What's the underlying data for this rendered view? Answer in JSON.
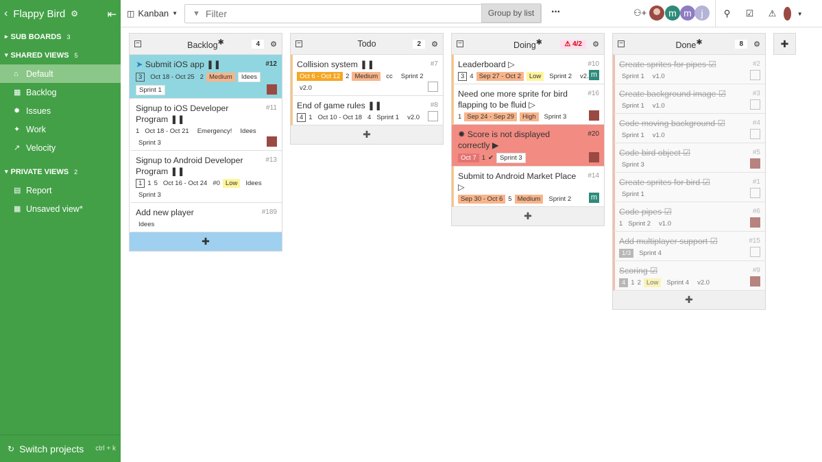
{
  "sidebar": {
    "project_name": "Flappy Bird",
    "sub_boards": {
      "label": "SUB BOARDS",
      "count": "3"
    },
    "shared_views": {
      "label": "SHARED VIEWS",
      "count": "5"
    },
    "shared_items": [
      "Default",
      "Backlog",
      "Issues",
      "Work",
      "Velocity"
    ],
    "private_views": {
      "label": "PRIVATE VIEWS",
      "count": "2"
    },
    "private_items": [
      "Report",
      "Unsaved view*"
    ],
    "switch_label": "Switch projects",
    "switch_shortcut": "ctrl + k"
  },
  "topbar": {
    "view": "Kanban",
    "filter_placeholder": "Filter",
    "group_by": "Group by list",
    "avatars": [
      "m",
      "m",
      "j"
    ]
  },
  "columns": {
    "backlog": {
      "title": "Backlog",
      "count": "4",
      "cards": [
        {
          "title": "Submit iOS app",
          "num": "#12",
          "meta": [
            "3",
            "Oct 18 - Oct 25",
            "2",
            "Medium",
            "Idees",
            "Sprint 1"
          ]
        },
        {
          "title": "Signup to iOS Developer Program",
          "num": "#11",
          "meta": [
            "1",
            "Oct 18 - Oct 21",
            "Emergency!",
            "Idees",
            "Sprint 3"
          ]
        },
        {
          "title": "Signup to Android Developer Program",
          "num": "#13",
          "meta": [
            "1",
            "1",
            "5",
            "Oct 16 - Oct 24",
            "#0",
            "Low",
            "Idees",
            "Sprint 3"
          ]
        },
        {
          "title": "Add new player",
          "num": "#189",
          "meta": [
            "Idees"
          ]
        }
      ]
    },
    "todo": {
      "title": "Todo",
      "count": "2",
      "cards": [
        {
          "title": "Collision system",
          "num": "#7",
          "meta": [
            "Oct 6 - Oct 12",
            "2",
            "Medium",
            "cc",
            "Sprint 2",
            "v2.0"
          ]
        },
        {
          "title": "End of game rules",
          "num": "#8",
          "meta": [
            "4",
            "1",
            "Oct 10 - Oct 18",
            "4",
            "Sprint 1",
            "v2.0"
          ]
        }
      ]
    },
    "doing": {
      "title": "Doing",
      "count": "4/2",
      "cards": [
        {
          "title": "Leaderboard",
          "num": "#10",
          "meta": [
            "3",
            "4",
            "Sep 27 - Oct 2",
            "Low",
            "Sprint 2",
            "v2.0"
          ]
        },
        {
          "title": "Need one more sprite for bird flapping to be fluid",
          "num": "#16",
          "meta": [
            "1",
            "Sep 24 - Sep 29",
            "High",
            "Sprint 3"
          ]
        },
        {
          "title": "Score is not displayed correctly",
          "num": "#20",
          "meta": [
            "Oct 7",
            "1",
            "Sprint 3"
          ]
        },
        {
          "title": "Submit to Android Market Place",
          "num": "#14",
          "meta": [
            "Sep 30 - Oct 6",
            "5",
            "Medium",
            "Sprint 2"
          ]
        }
      ]
    },
    "done": {
      "title": "Done",
      "count": "8",
      "cards": [
        {
          "title": "Create sprites for pipes",
          "num": "#2",
          "meta": [
            "Sprint 1",
            "v1.0"
          ]
        },
        {
          "title": "Create background image",
          "num": "#3",
          "meta": [
            "Sprint 1",
            "v1.0"
          ]
        },
        {
          "title": "Code moving background",
          "num": "#4",
          "meta": [
            "Sprint 1",
            "v1.0"
          ]
        },
        {
          "title": "Code bird object",
          "num": "#5",
          "meta": [
            "Sprint 3"
          ]
        },
        {
          "title": "Create sprites for bird",
          "num": "#1",
          "meta": [
            "Sprint 1"
          ]
        },
        {
          "title": "Code pipes",
          "num": "#6",
          "meta": [
            "1",
            "Sprint 2",
            "v1.0"
          ]
        },
        {
          "title": "Add multiplayer support",
          "num": "#15",
          "meta": [
            "1/3",
            "Sprint 4"
          ]
        },
        {
          "title": "Scoring",
          "num": "#9",
          "meta": [
            "4",
            "1",
            "2",
            "Low",
            "Sprint 4",
            "v2.0"
          ]
        }
      ]
    }
  },
  "colors": {
    "sidebar": "#43a047",
    "active_nav": "#8bc788",
    "add_button": "#9fd0f0",
    "error_card": "#f28b82"
  }
}
